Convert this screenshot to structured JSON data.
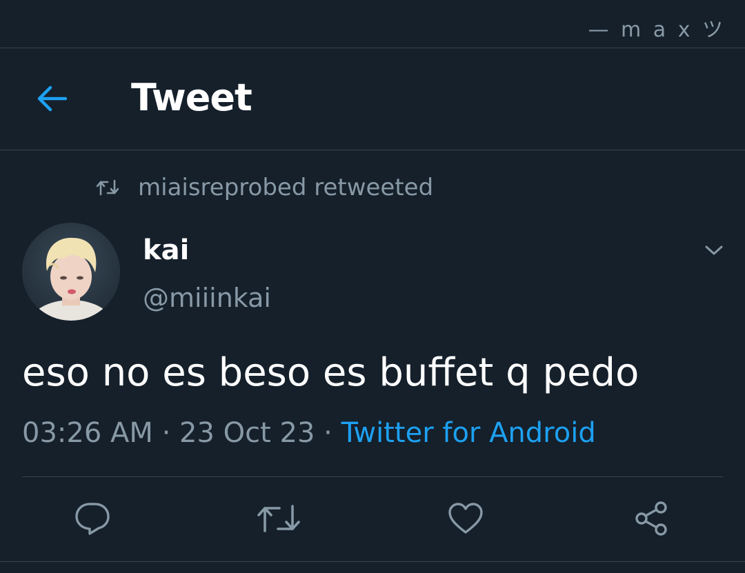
{
  "watermark": "— m a x ツ",
  "header": {
    "title": "Tweet",
    "back_icon": "arrow-left-icon"
  },
  "retweet": {
    "text": "miaisreprobed retweeted",
    "icon": "retweet-icon"
  },
  "author": {
    "display_name": "kai",
    "handle": "@miiinkai"
  },
  "tweet": {
    "text": "eso no es beso es buffet q pedo",
    "time": "03:26 AM",
    "separator1": " · ",
    "date": "23 Oct 23",
    "separator2": " · ",
    "source": "Twitter for Android"
  },
  "actions": [
    {
      "name": "reply",
      "icon": "reply-icon"
    },
    {
      "name": "retweet",
      "icon": "retweet-icon"
    },
    {
      "name": "like",
      "icon": "heart-icon"
    },
    {
      "name": "share",
      "icon": "share-icon"
    }
  ],
  "colors": {
    "background": "#15202b",
    "accent": "#1da1f2",
    "secondary_text": "#8899a6",
    "divider": "#38444d"
  }
}
